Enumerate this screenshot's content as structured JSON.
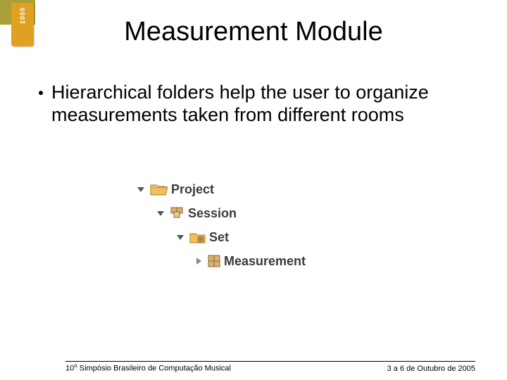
{
  "badge_year": "2005",
  "title": "Measurement Module",
  "bullet": "Hierarchical folders help the user to organize measurements taken from different rooms",
  "tree": {
    "n0": "Project",
    "n1": "Session",
    "n2": "Set",
    "n3": "Measurement"
  },
  "footer": {
    "left_prefix": "10",
    "left_sup": "o",
    "left_rest": " Simpósio Brasileiro de Computação Musical",
    "right": "3 a 6 de Outubro de 2005"
  }
}
